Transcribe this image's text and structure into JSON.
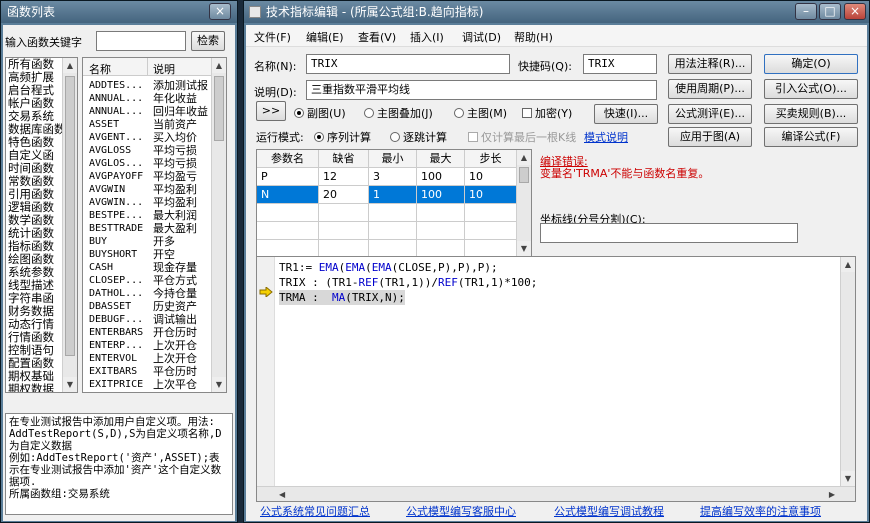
{
  "left": {
    "title": "函数列表",
    "close": "×",
    "search_label": "输入函数关键字",
    "search_value": "",
    "search_button": "检索",
    "categories": [
      "所有函数",
      "高频扩展",
      "启台程式",
      "帐户函数",
      "交易系统",
      "数据库函数",
      "特色函数",
      "自定义函",
      "时间函数",
      "常数函数",
      "引用函数",
      "逻辑函数",
      "数学函数",
      "统计函数",
      "指标函数",
      "绘图函数",
      "系统参数",
      "线型描述",
      "字符串函",
      "财务数据",
      "动态行情",
      "行情函数",
      "控制语句",
      "配置函数",
      "期权基础",
      "期权数据"
    ],
    "list_headers": [
      "名称",
      "说明"
    ],
    "functions": [
      [
        "ADDTES...",
        "添加测试报"
      ],
      [
        "ANNUAL...",
        "年化收益"
      ],
      [
        "ANNUAL...",
        "回归年收益"
      ],
      [
        "ASSET",
        "当前资产"
      ],
      [
        "AVGENT...",
        "买入均价"
      ],
      [
        "AVGLOSS",
        "平均亏损"
      ],
      [
        "AVGLOS...",
        "平均亏损"
      ],
      [
        "AVGPAYOFF",
        "平均盈亏"
      ],
      [
        "AVGWIN",
        "平均盈利"
      ],
      [
        "AVGWIN...",
        "平均盈利"
      ],
      [
        "BESTPE...",
        "最大利润"
      ],
      [
        "BESTTRADE",
        "最大盈利"
      ],
      [
        "BUY",
        "开多"
      ],
      [
        "BUYSHORT",
        "开空"
      ],
      [
        "CASH",
        "现金存量"
      ],
      [
        "CLOSEP...",
        "平仓方式"
      ],
      [
        "DATHOL...",
        "今持仓量"
      ],
      [
        "DBASSET",
        "历史资产"
      ],
      [
        "DEBUGF...",
        "调试输出"
      ],
      [
        "ENTERBARS",
        "开仓历时"
      ],
      [
        "ENTERP...",
        "上次开仓"
      ],
      [
        "ENTERVOL",
        "上次开仓"
      ],
      [
        "EXITBARS",
        "平仓历时"
      ],
      [
        "EXITPRICE",
        "上次平仓"
      ]
    ],
    "description": "在专业测试报告中添加用户自定义项。用法:\nAddTestReport(S,D),S为自定义项名称,D为自定义数据\n例如:AddTestReport('资产',ASSET);表示在专业测试报告中添加'资产'这个自定义数据项.\n所属函数组:交易系统"
  },
  "editor": {
    "title": "技术指标编辑 - (所属公式组:B.趋向指标)",
    "menu": [
      "文件(F)",
      "编辑(E)",
      "查看(V)",
      "插入(I)",
      "调试(D)",
      "帮助(H)"
    ],
    "name_label": "名称(N):",
    "name_value": "TRIX",
    "shortcut_label": "快捷码(Q):",
    "shortcut_value": "TRIX",
    "desc_label": "说明(D):",
    "desc_value": "三重指数平滑平均线",
    "expand_button": ">>",
    "radio_sub": "副图(U)",
    "radio_main_overlay": "主图叠加(J)",
    "radio_main": "主图(M)",
    "encrypt": "加密(Y)",
    "speed_button": "快速(I)...",
    "run_mode_label": "运行模式:",
    "run_seq": "序列计算",
    "run_tick": "逐跳计算",
    "only_last": "仅计算最后一根K线",
    "style_link": "模式说明",
    "buttons_right": [
      "用法注释(R)...",
      "使用周期(P)...",
      "公式测评(E)...",
      "应用于图(A)"
    ],
    "buttons_far": [
      "确定(O)",
      "引入公式(O)...",
      "买卖规则(B)...",
      "编译公式(F)"
    ],
    "param_headers": [
      "参数名",
      "缺省",
      "最小",
      "最大",
      "步长"
    ],
    "params": [
      [
        "P",
        "12",
        "3",
        "100",
        "10"
      ],
      [
        "N",
        "20",
        "1",
        "100",
        "10"
      ]
    ],
    "compile_error_title": "编译错误:",
    "compile_error_msg": "变量名'TRMA'不能与函数名重复。",
    "axis_label": "坐标线(分号分割)(C):",
    "axis_value": "",
    "code_lines": [
      "TR1:= EMA(EMA(EMA(CLOSE,P),P),P);",
      "TRIX : (TR1-REF(TR1,1))/REF(TR1,1)*100;",
      "TRMA :  MA(TRIX,N);"
    ],
    "footer_links": [
      "公式系统常见问题汇总",
      "公式模型编写客服中心",
      "公式模型编写调试教程",
      "提高编写效率的注意事项"
    ]
  },
  "colors": {
    "selected_row": "#0078d7",
    "error": "#cc0000",
    "keyword": "#0000cc",
    "link": "#0033cc"
  }
}
